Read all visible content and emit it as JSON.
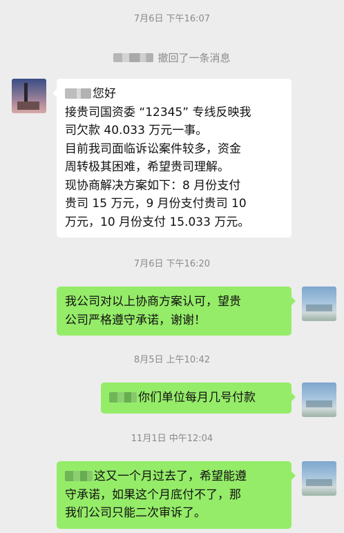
{
  "chat": {
    "timestamps": [
      "7月6日 下午16:07",
      "7月6日 下午16:20",
      "8月5日 上午10:42",
      "11月1日 中午12:04"
    ],
    "recall_notice": "撤回了一条消息",
    "messages": [
      {
        "side": "left",
        "lines": [
          "您好",
          "接贵司国资委 “12345” 专线反映我",
          "司欠款 40.033 万元一事。",
          "目前我司面临诉讼案件较多，资金",
          "周转极其困难，希望贵司理解。",
          "现协商解决方案如下：8 月份支付",
          "贵司 15 万元，9 月份支付贵司 10",
          "万元，10 月份支付 15.033 万元。"
        ]
      },
      {
        "side": "right",
        "lines": [
          "我公司对以上协商方案认可，望贵",
          "公司严格遵守承诺，谢谢！"
        ]
      },
      {
        "side": "right",
        "lines": [
          "你们单位每月几号付款"
        ]
      },
      {
        "side": "right",
        "lines": [
          "这又一个月过去了，希望能遵",
          "守承诺，如果这个月底付不了，那",
          "我们公司只能二次审诉了。"
        ]
      }
    ]
  },
  "colors": {
    "background": "#ededed",
    "incoming_bubble": "#ffffff",
    "outgoing_bubble": "#95ec69",
    "timestamp_text": "#8a8a8a"
  }
}
